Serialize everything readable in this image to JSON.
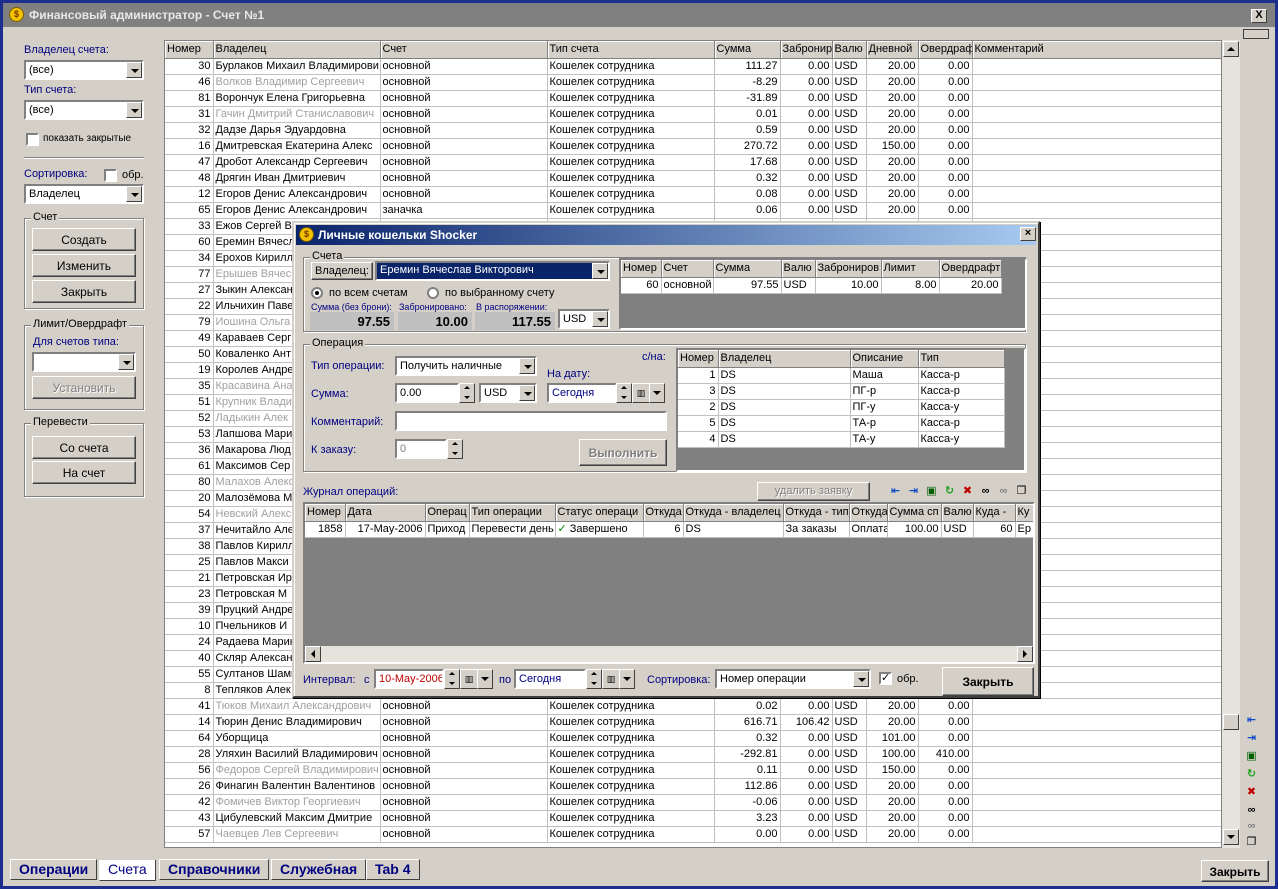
{
  "window": {
    "title": "Финансовый администратор - Счет №1",
    "close": "X"
  },
  "sidebar": {
    "owner_label": "Владелец счета:",
    "owner_value": "(все)",
    "acct_type_label": "Тип счета:",
    "acct_type_value": "(все)",
    "show_closed": "показать закрытые",
    "sort_label": "Сортировка:",
    "sort_rev": "обр.",
    "sort_value": "Владелец",
    "account_group": "Счет",
    "btn_create": "Создать",
    "btn_change": "Изменить",
    "btn_close": "Закрыть",
    "limit_group": "Лимит/Овердрафт",
    "for_types_label": "Для счетов типа:",
    "btn_set": "Установить",
    "transfer_group": "Перевести",
    "btn_from": "Со счета",
    "btn_to": "На счет"
  },
  "grid": {
    "headers": [
      "Номер",
      "Владелец",
      "Счет",
      "Тип счета",
      "Сумма",
      "Забронир",
      "Валю",
      "Дневной",
      "Овердраф",
      "Комментарий"
    ],
    "rows": [
      {
        "n": "30",
        "owner": "Бурлаков Михаил Владимирови",
        "acct": "основной",
        "type": "Кошелек сотрудника",
        "sum": "111.27",
        "res": "0.00",
        "cur": "USD",
        "day": "20.00",
        "ovd": "0.00",
        "gray": false
      },
      {
        "n": "46",
        "owner": "Волков Владимир Сергеевич",
        "acct": "основной",
        "type": "Кошелек сотрудника",
        "sum": "-8.29",
        "res": "0.00",
        "cur": "USD",
        "day": "20.00",
        "ovd": "0.00",
        "gray": true
      },
      {
        "n": "81",
        "owner": "Ворончук Елена Григорьевна",
        "acct": "основной",
        "type": "Кошелек сотрудника",
        "sum": "-31.89",
        "res": "0.00",
        "cur": "USD",
        "day": "20.00",
        "ovd": "0.00",
        "gray": false
      },
      {
        "n": "31",
        "owner": "Гачин Дмитрий Станиславович",
        "acct": "основной",
        "type": "Кошелек сотрудника",
        "sum": "0.01",
        "res": "0.00",
        "cur": "USD",
        "day": "20.00",
        "ovd": "0.00",
        "gray": true
      },
      {
        "n": "32",
        "owner": "Дадзе Дарья Эдуардовна",
        "acct": "основной",
        "type": "Кошелек сотрудника",
        "sum": "0.59",
        "res": "0.00",
        "cur": "USD",
        "day": "20.00",
        "ovd": "0.00",
        "gray": false
      },
      {
        "n": "16",
        "owner": "Дмитревская Екатерина Алекс",
        "acct": "основной",
        "type": "Кошелек сотрудника",
        "sum": "270.72",
        "res": "0.00",
        "cur": "USD",
        "day": "150.00",
        "ovd": "0.00",
        "gray": false
      },
      {
        "n": "47",
        "owner": "Дробот Александр Сергеевич",
        "acct": "основной",
        "type": "Кошелек сотрудника",
        "sum": "17.68",
        "res": "0.00",
        "cur": "USD",
        "day": "20.00",
        "ovd": "0.00",
        "gray": false
      },
      {
        "n": "48",
        "owner": "Дрягин Иван Дмитриевич",
        "acct": "основной",
        "type": "Кошелек сотрудника",
        "sum": "0.32",
        "res": "0.00",
        "cur": "USD",
        "day": "20.00",
        "ovd": "0.00",
        "gray": false
      },
      {
        "n": "12",
        "owner": "Егоров Денис Александрович",
        "acct": "основной",
        "type": "Кошелек сотрудника",
        "sum": "0.08",
        "res": "0.00",
        "cur": "USD",
        "day": "20.00",
        "ovd": "0.00",
        "gray": false
      },
      {
        "n": "65",
        "owner": "Егоров Денис Александрович",
        "acct": "заначка",
        "type": "Кошелек сотрудника",
        "sum": "0.06",
        "res": "0.00",
        "cur": "USD",
        "day": "20.00",
        "ovd": "0.00",
        "gray": false
      },
      {
        "n": "33",
        "owner": "Ежов Сергей В",
        "acct": "",
        "type": "",
        "sum": "",
        "res": "",
        "cur": "",
        "day": "",
        "ovd": "",
        "gray": false
      },
      {
        "n": "60",
        "owner": "Еремин Вячесл",
        "acct": "",
        "type": "",
        "sum": "",
        "res": "",
        "cur": "",
        "day": "",
        "ovd": "",
        "gray": false
      },
      {
        "n": "34",
        "owner": "Ерохов Кирилл",
        "acct": "",
        "type": "",
        "sum": "",
        "res": "",
        "cur": "",
        "day": "",
        "ovd": "",
        "gray": false
      },
      {
        "n": "77",
        "owner": "Ерышев Вячес",
        "acct": "",
        "type": "",
        "sum": "",
        "res": "",
        "cur": "",
        "day": "",
        "ovd": "",
        "gray": true
      },
      {
        "n": "27",
        "owner": "Зыкин Алексан",
        "acct": "",
        "type": "",
        "sum": "",
        "res": "",
        "cur": "",
        "day": "",
        "ovd": "",
        "gray": false
      },
      {
        "n": "22",
        "owner": "Ильчихин Паве",
        "acct": "",
        "type": "",
        "sum": "",
        "res": "",
        "cur": "",
        "day": "",
        "ovd": "",
        "gray": false
      },
      {
        "n": "79",
        "owner": "Иошина Ольга",
        "acct": "",
        "type": "",
        "sum": "",
        "res": "",
        "cur": "",
        "day": "",
        "ovd": "",
        "gray": true
      },
      {
        "n": "49",
        "owner": "Караваев Серг",
        "acct": "",
        "type": "",
        "sum": "",
        "res": "",
        "cur": "",
        "day": "",
        "ovd": "",
        "gray": false
      },
      {
        "n": "50",
        "owner": "Коваленко Ант",
        "acct": "",
        "type": "",
        "sum": "",
        "res": "",
        "cur": "",
        "day": "",
        "ovd": "",
        "gray": false
      },
      {
        "n": "19",
        "owner": "Королев Андре",
        "acct": "",
        "type": "",
        "sum": "",
        "res": "",
        "cur": "",
        "day": "",
        "ovd": "",
        "gray": false
      },
      {
        "n": "35",
        "owner": "Красавина Ана",
        "acct": "",
        "type": "",
        "sum": "",
        "res": "",
        "cur": "",
        "day": "",
        "ovd": "",
        "gray": true
      },
      {
        "n": "51",
        "owner": "Крупник Влади",
        "acct": "",
        "type": "",
        "sum": "",
        "res": "",
        "cur": "",
        "day": "",
        "ovd": "",
        "gray": true
      },
      {
        "n": "52",
        "owner": "Ладыкин Алек",
        "acct": "",
        "type": "",
        "sum": "",
        "res": "",
        "cur": "",
        "day": "",
        "ovd": "",
        "gray": true
      },
      {
        "n": "53",
        "owner": "Лапшова Мари",
        "acct": "",
        "type": "",
        "sum": "",
        "res": "",
        "cur": "",
        "day": "",
        "ovd": "",
        "gray": false
      },
      {
        "n": "36",
        "owner": "Макарова Люд",
        "acct": "",
        "type": "",
        "sum": "",
        "res": "",
        "cur": "",
        "day": "",
        "ovd": "",
        "gray": false
      },
      {
        "n": "61",
        "owner": "Максимов Сер",
        "acct": "",
        "type": "",
        "sum": "",
        "res": "",
        "cur": "",
        "day": "",
        "ovd": "",
        "gray": false
      },
      {
        "n": "80",
        "owner": "Малахов Алекс",
        "acct": "",
        "type": "",
        "sum": "",
        "res": "",
        "cur": "",
        "day": "",
        "ovd": "",
        "gray": true
      },
      {
        "n": "20",
        "owner": "Малозёмова М",
        "acct": "",
        "type": "",
        "sum": "",
        "res": "",
        "cur": "",
        "day": "",
        "ovd": "",
        "gray": false
      },
      {
        "n": "54",
        "owner": "Невский Алекс",
        "acct": "",
        "type": "",
        "sum": "",
        "res": "",
        "cur": "",
        "day": "",
        "ovd": "",
        "gray": true
      },
      {
        "n": "37",
        "owner": "Нечитайло Але",
        "acct": "",
        "type": "",
        "sum": "",
        "res": "",
        "cur": "",
        "day": "",
        "ovd": "",
        "gray": false
      },
      {
        "n": "38",
        "owner": "Павлов Кирилл",
        "acct": "",
        "type": "",
        "sum": "",
        "res": "",
        "cur": "",
        "day": "",
        "ovd": "",
        "gray": false
      },
      {
        "n": "25",
        "owner": "Павлов Макси",
        "acct": "",
        "type": "",
        "sum": "",
        "res": "",
        "cur": "",
        "day": "",
        "ovd": "",
        "gray": false
      },
      {
        "n": "21",
        "owner": "Петровская Ир",
        "acct": "",
        "type": "",
        "sum": "",
        "res": "",
        "cur": "",
        "day": "",
        "ovd": "",
        "gray": false
      },
      {
        "n": "23",
        "owner": "Петровская М",
        "acct": "",
        "type": "",
        "sum": "",
        "res": "",
        "cur": "",
        "day": "",
        "ovd": "",
        "gray": false
      },
      {
        "n": "39",
        "owner": "Пруцкий Андре",
        "acct": "",
        "type": "",
        "sum": "",
        "res": "",
        "cur": "",
        "day": "",
        "ovd": "",
        "gray": false
      },
      {
        "n": "10",
        "owner": "Пчельников И",
        "acct": "",
        "type": "",
        "sum": "",
        "res": "",
        "cur": "",
        "day": "",
        "ovd": "",
        "gray": false
      },
      {
        "n": "24",
        "owner": "Радаева Марин",
        "acct": "",
        "type": "",
        "sum": "",
        "res": "",
        "cur": "",
        "day": "",
        "ovd": "",
        "gray": false
      },
      {
        "n": "40",
        "owner": "Скляр Алексан",
        "acct": "",
        "type": "",
        "sum": "",
        "res": "",
        "cur": "",
        "day": "",
        "ovd": "",
        "gray": false
      },
      {
        "n": "55",
        "owner": "Султанов Шами",
        "acct": "",
        "type": "",
        "sum": "",
        "res": "",
        "cur": "",
        "day": "",
        "ovd": "",
        "gray": false
      },
      {
        "n": "8",
        "owner": "Тепляков Алек",
        "acct": "",
        "type": "",
        "sum": "",
        "res": "",
        "cur": "",
        "day": "",
        "ovd": "",
        "gray": false
      },
      {
        "n": "41",
        "owner": "Тюков Михаил Александрович",
        "acct": "основной",
        "type": "Кошелек сотрудника",
        "sum": "0.02",
        "res": "0.00",
        "cur": "USD",
        "day": "20.00",
        "ovd": "0.00",
        "gray": true
      },
      {
        "n": "14",
        "owner": "Тюрин Денис Владимирович",
        "acct": "основной",
        "type": "Кошелек сотрудника",
        "sum": "616.71",
        "res": "106.42",
        "cur": "USD",
        "day": "20.00",
        "ovd": "0.00",
        "gray": false
      },
      {
        "n": "64",
        "owner": "Уборщица",
        "acct": "основной",
        "type": "Кошелек сотрудника",
        "sum": "0.32",
        "res": "0.00",
        "cur": "USD",
        "day": "101.00",
        "ovd": "0.00",
        "gray": false
      },
      {
        "n": "28",
        "owner": "Уляхин Василий Владимирович",
        "acct": "основной",
        "type": "Кошелек сотрудника",
        "sum": "-292.81",
        "res": "0.00",
        "cur": "USD",
        "day": "100.00",
        "ovd": "410.00",
        "gray": false
      },
      {
        "n": "56",
        "owner": "Федоров Сергей Владимирович",
        "acct": "основной",
        "type": "Кошелек сотрудника",
        "sum": "0.11",
        "res": "0.00",
        "cur": "USD",
        "day": "150.00",
        "ovd": "0.00",
        "gray": true
      },
      {
        "n": "26",
        "owner": "Финагин Валентин Валентинов",
        "acct": "основной",
        "type": "Кошелек сотрудника",
        "sum": "112.86",
        "res": "0.00",
        "cur": "USD",
        "day": "20.00",
        "ovd": "0.00",
        "gray": false
      },
      {
        "n": "42",
        "owner": "Фомичев Виктор Георгиевич",
        "acct": "основной",
        "type": "Кошелек сотрудника",
        "sum": "-0.06",
        "res": "0.00",
        "cur": "USD",
        "day": "20.00",
        "ovd": "0.00",
        "gray": true
      },
      {
        "n": "43",
        "owner": "Цибулевский Максим Дмитрие",
        "acct": "основной",
        "type": "Кошелек сотрудника",
        "sum": "3.23",
        "res": "0.00",
        "cur": "USD",
        "day": "20.00",
        "ovd": "0.00",
        "gray": false
      },
      {
        "n": "57",
        "owner": "Чаевцев Лев Сергеевич",
        "acct": "основной",
        "type": "Кошелек сотрудника",
        "sum": "0.00",
        "res": "0.00",
        "cur": "USD",
        "day": "20.00",
        "ovd": "0.00",
        "gray": true
      }
    ]
  },
  "tabs": [
    "Операции",
    "Счета",
    "Справочники",
    "Служебная",
    "Tab 4"
  ],
  "bottom_close": "Закрыть",
  "dialog": {
    "title": "Личные кошельки Shocker",
    "accounts_group": "Счета",
    "owner_btn": "Владелец:",
    "owner_value": "Еремин Вячеслав Викторович",
    "radio_all": "по всем счетам",
    "radio_selected": "по выбранному счету",
    "sum_label": "Сумма (без брони):",
    "reserved_label": "Забронировано:",
    "available_label": "В распоряжении:",
    "sum_value": "97.55",
    "reserved_value": "10.00",
    "available_value": "117.55",
    "currency": "USD",
    "acct_table": {
      "headers": [
        "Номер",
        "Счет",
        "Сумма",
        "Валю",
        "Заброниров",
        "Лимит",
        "Овердрафт"
      ],
      "row": [
        "60",
        "основной",
        "97.55",
        "USD",
        "10.00",
        "8.00",
        "20.00"
      ]
    },
    "operation_group": "Операция",
    "op_type_label": "Тип операции:",
    "op_type_value": "Получить наличные",
    "amount_label": "Сумма:",
    "amount_value": "0.00",
    "amount_currency": "USD",
    "date_label": "На дату:",
    "date_value": "Сегодня",
    "comment_label": "Комментарий:",
    "order_label": "К заказу:",
    "order_value": "0",
    "execute_btn": "Выполнить",
    "cn_label": "с/на:",
    "cn_table": {
      "headers": [
        "Номер",
        "Владелец",
        "Описание",
        "Тип"
      ],
      "rows": [
        [
          "1",
          "DS",
          "Маша",
          "Касса-р"
        ],
        [
          "3",
          "DS",
          "ПГ-р",
          "Касса-р"
        ],
        [
          "2",
          "DS",
          "ПГ-у",
          "Касса-у"
        ],
        [
          "5",
          "DS",
          "ТА-р",
          "Касса-р"
        ],
        [
          "4",
          "DS",
          "ТА-у",
          "Касса-у"
        ]
      ]
    },
    "journal_label": "Журнал операций:",
    "delete_request_btn": "удалить заявку",
    "journal_table": {
      "headers": [
        "Номер",
        "Дата",
        "Операц",
        "Тип операции",
        "Статус  операци",
        "Откуда",
        "Откуда - владелец",
        "Откуда - тип",
        "Откуда",
        "Сумма сп",
        "Валю",
        "Куда -",
        "Ку"
      ],
      "rows": [
        [
          "1858",
          "17-May-2006",
          "Приход",
          "Перевести день",
          "Завершено",
          "6",
          "DS",
          "За заказы",
          "Оплата",
          "100.00",
          "USD",
          "60",
          "Ер"
        ]
      ]
    },
    "interval_label": "Интервал:",
    "from_label": "с",
    "from_value": "10-May-2006",
    "to_label": "по",
    "to_value": "Сегодня",
    "sort_label": "Сортировка:",
    "sort_value": "Номер операции",
    "sort_rev": "обр.",
    "close_btn": "Закрыть"
  }
}
